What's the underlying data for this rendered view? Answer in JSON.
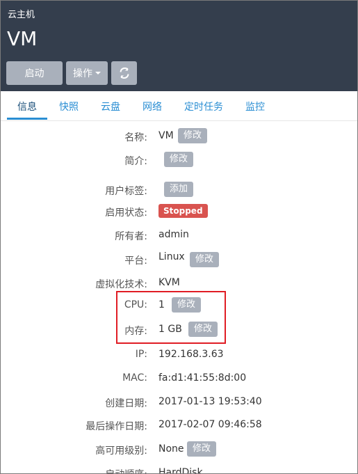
{
  "header": {
    "breadcrumb": "云主机",
    "title": "VM",
    "start_label": "启动",
    "operations_label": "操作",
    "refresh_icon": "refresh-icon"
  },
  "tabs": [
    {
      "label": "信息"
    },
    {
      "label": "快照"
    },
    {
      "label": "云盘"
    },
    {
      "label": "网络"
    },
    {
      "label": "定时任务"
    },
    {
      "label": "监控"
    }
  ],
  "info": {
    "name": {
      "label": "名称:",
      "value": "VM",
      "action": "修改"
    },
    "description": {
      "label": "简介:",
      "action": "修改"
    },
    "user_tags": {
      "label": "用户标签:",
      "action": "添加"
    },
    "state": {
      "label": "启用状态:",
      "value": "Stopped",
      "color": "#d9534f"
    },
    "owner": {
      "label": "所有者:",
      "value": "admin"
    },
    "platform": {
      "label": "平台:",
      "value": "Linux",
      "action": "修改"
    },
    "hypervisor": {
      "label": "虚拟化技术:",
      "value": "KVM"
    },
    "cpu": {
      "label": "CPU:",
      "value": "1",
      "action": "修改"
    },
    "memory": {
      "label": "内存:",
      "value": "1 GB",
      "action": "修改"
    },
    "ip": {
      "label": "IP:",
      "value": "192.168.3.63"
    },
    "mac": {
      "label": "MAC:",
      "value": "fa:d1:41:55:8d:00"
    },
    "created": {
      "label": "创建日期:",
      "value": "2017-01-13 19:53:40"
    },
    "last_op": {
      "label": "最后操作日期:",
      "value": "2017-02-07 09:46:58"
    },
    "ha_level": {
      "label": "高可用级别:",
      "value": "None",
      "action": "修改"
    },
    "boot_order": {
      "label": "启动顺序:",
      "value": "HardDisk"
    }
  },
  "colors": {
    "header_bg": "#343e4d",
    "button_bg": "#a9b0bb",
    "tab_accent": "#2a8ed3",
    "highlight_border": "#e01c24"
  }
}
